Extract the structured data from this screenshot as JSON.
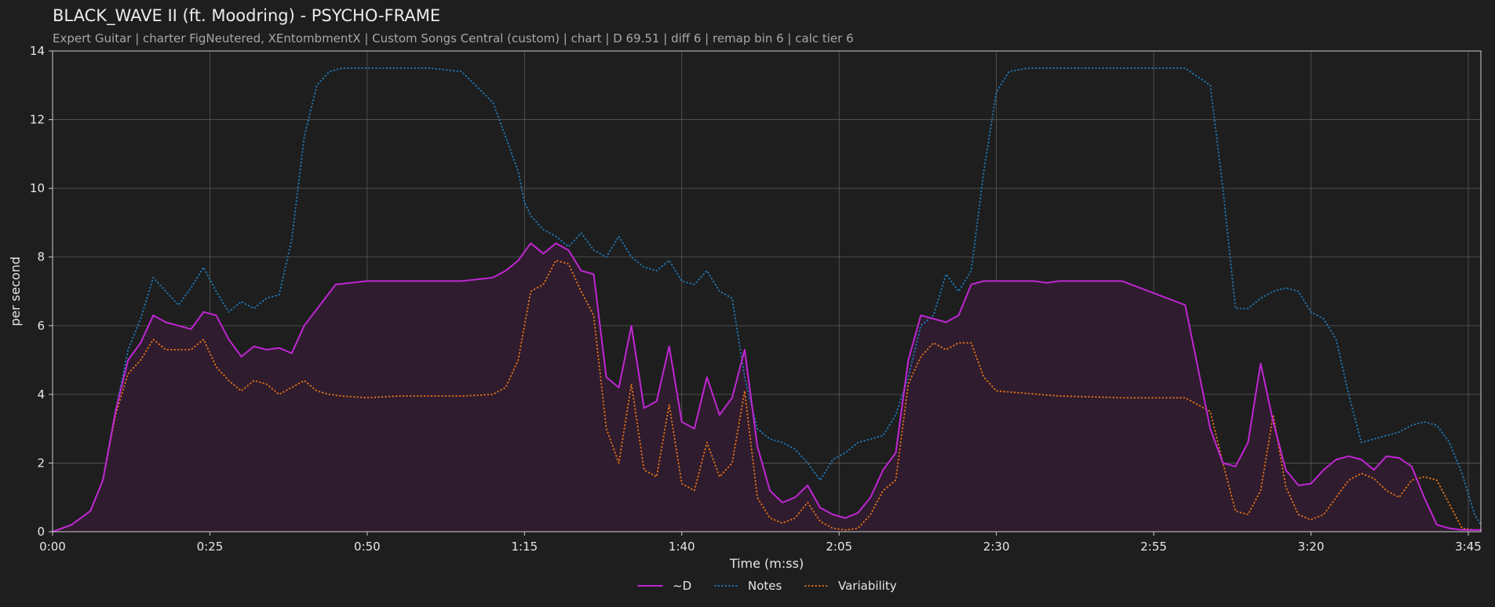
{
  "header": {
    "title": "BLACK_WAVE II (ft. Moodring) - PSYCHO-FRAME",
    "subtitle": "Expert Guitar  |  charter FigNeutered, XEntombmentX  |  Custom Songs Central (custom)  |  chart  |  D 69.51  |  diff 6  |  remap bin 6  |  calc tier 6"
  },
  "colors": {
    "background": "#1e1e1e",
    "d_line": "#c026d3",
    "d_fill": "#2f1c2e",
    "notes": "#1f77b4",
    "variability": "#e0701a",
    "grid": "#5a5a5a",
    "axis": "#cfcfcf"
  },
  "chart_data": {
    "type": "line",
    "title": "BLACK_WAVE II (ft. Moodring) - PSYCHO-FRAME",
    "xlabel": "Time (m:ss)",
    "ylabel": "per second",
    "xlim": [
      0,
      227
    ],
    "ylim": [
      0,
      14
    ],
    "grid": true,
    "legend_position": "bottom-center",
    "x_ticks": [
      0,
      25,
      50,
      75,
      100,
      125,
      150,
      175,
      200,
      225
    ],
    "x_tick_labels": [
      "0:00",
      "0:25",
      "0:50",
      "1:15",
      "1:40",
      "2:05",
      "2:30",
      "2:55",
      "3:20",
      "3:45"
    ],
    "y_ticks": [
      0,
      2,
      4,
      6,
      8,
      10,
      12,
      14
    ],
    "y_tick_labels": [
      "0",
      "2",
      "4",
      "6",
      "8",
      "10",
      "12",
      "14"
    ],
    "series": [
      {
        "name": "~D",
        "style": "solid",
        "filled": true,
        "x": [
          0,
          3,
          6,
          8,
          10,
          12,
          14,
          16,
          18,
          20,
          22,
          24,
          26,
          28,
          30,
          32,
          34,
          36,
          38,
          40,
          45,
          50,
          55,
          60,
          65,
          70,
          72,
          74,
          76,
          78,
          80,
          82,
          84,
          86,
          88,
          90,
          92,
          94,
          96,
          98,
          100,
          102,
          104,
          106,
          108,
          110,
          112,
          114,
          116,
          118,
          120,
          122,
          124,
          126,
          128,
          130,
          132,
          134,
          136,
          138,
          140,
          142,
          144,
          146,
          148,
          150,
          152,
          154,
          156,
          158,
          160,
          170,
          180,
          184,
          186,
          188,
          190,
          192,
          194,
          196,
          198,
          200,
          202,
          204,
          206,
          208,
          210,
          212,
          214,
          216,
          218,
          220,
          222,
          224,
          226,
          227
        ],
        "y": [
          0.0,
          0.2,
          0.6,
          1.5,
          3.5,
          5.0,
          5.5,
          6.3,
          6.1,
          6.0,
          5.9,
          6.4,
          6.3,
          5.6,
          5.1,
          5.4,
          5.3,
          5.35,
          5.2,
          6.0,
          7.2,
          7.3,
          7.3,
          7.3,
          7.3,
          7.4,
          7.6,
          7.9,
          8.4,
          8.1,
          8.4,
          8.2,
          7.6,
          7.5,
          4.5,
          4.2,
          6.0,
          3.6,
          3.8,
          5.4,
          3.2,
          3.0,
          4.5,
          3.4,
          3.9,
          5.3,
          2.5,
          1.2,
          0.85,
          1.0,
          1.35,
          0.7,
          0.5,
          0.4,
          0.55,
          1.0,
          1.8,
          2.3,
          5.0,
          6.3,
          6.2,
          6.1,
          6.3,
          7.2,
          7.3,
          7.3,
          7.3,
          7.3,
          7.3,
          7.25,
          7.3,
          7.3,
          6.6,
          3.0,
          2.0,
          1.9,
          2.6,
          4.9,
          3.2,
          1.8,
          1.35,
          1.4,
          1.8,
          2.1,
          2.2,
          2.1,
          1.8,
          2.2,
          2.15,
          1.9,
          1.0,
          0.2,
          0.1,
          0.05,
          0.05,
          0.05
        ]
      },
      {
        "name": "Notes",
        "style": "dotted",
        "filled": false,
        "x": [
          0,
          3,
          6,
          8,
          10,
          12,
          14,
          16,
          18,
          20,
          22,
          24,
          26,
          28,
          30,
          32,
          34,
          36,
          38,
          40,
          42,
          44,
          46,
          50,
          55,
          60,
          65,
          70,
          72,
          74,
          75,
          76,
          78,
          80,
          82,
          84,
          86,
          88,
          90,
          92,
          94,
          96,
          98,
          100,
          102,
          104,
          106,
          108,
          110,
          112,
          114,
          116,
          118,
          120,
          122,
          124,
          126,
          128,
          130,
          132,
          134,
          136,
          138,
          140,
          142,
          144,
          146,
          148,
          150,
          152,
          155,
          160,
          170,
          180,
          184,
          186,
          188,
          190,
          192,
          194,
          196,
          198,
          200,
          202,
          204,
          206,
          208,
          210,
          212,
          214,
          216,
          218,
          220,
          222,
          224,
          226,
          227
        ],
        "y": [
          0.0,
          0.2,
          0.6,
          1.5,
          3.5,
          5.3,
          6.2,
          7.4,
          7.0,
          6.6,
          7.1,
          7.7,
          7.0,
          6.4,
          6.7,
          6.5,
          6.8,
          6.9,
          8.5,
          11.5,
          13.0,
          13.4,
          13.5,
          13.5,
          13.5,
          13.5,
          13.4,
          12.5,
          11.5,
          10.5,
          9.6,
          9.2,
          8.8,
          8.6,
          8.3,
          8.7,
          8.2,
          8.0,
          8.6,
          8.0,
          7.7,
          7.6,
          7.9,
          7.3,
          7.2,
          7.6,
          7.0,
          6.8,
          4.5,
          3.0,
          2.7,
          2.6,
          2.4,
          2.0,
          1.5,
          2.1,
          2.3,
          2.6,
          2.7,
          2.8,
          3.4,
          4.5,
          6.0,
          6.3,
          7.5,
          7.0,
          7.6,
          10.5,
          12.8,
          13.4,
          13.5,
          13.5,
          13.5,
          13.5,
          13.0,
          10.0,
          6.5,
          6.5,
          6.8,
          7.0,
          7.1,
          7.0,
          6.4,
          6.2,
          5.6,
          4.0,
          2.6,
          2.7,
          2.8,
          2.9,
          3.1,
          3.2,
          3.1,
          2.6,
          1.7,
          0.5,
          0.2
        ]
      },
      {
        "name": "Variability",
        "style": "dotted",
        "filled": false,
        "x": [
          0,
          3,
          6,
          8,
          10,
          12,
          14,
          16,
          18,
          20,
          22,
          24,
          26,
          28,
          30,
          32,
          34,
          36,
          38,
          40,
          42,
          44,
          46,
          50,
          55,
          60,
          65,
          70,
          72,
          74,
          76,
          78,
          80,
          82,
          84,
          86,
          88,
          90,
          92,
          94,
          96,
          98,
          100,
          102,
          104,
          106,
          108,
          110,
          112,
          114,
          116,
          118,
          120,
          122,
          124,
          126,
          128,
          130,
          132,
          134,
          136,
          138,
          140,
          142,
          144,
          146,
          148,
          150,
          160,
          170,
          180,
          184,
          186,
          188,
          190,
          192,
          194,
          196,
          198,
          200,
          202,
          204,
          206,
          208,
          210,
          212,
          214,
          216,
          218,
          220,
          222,
          224,
          226,
          227
        ],
        "y": [
          0.0,
          0.2,
          0.6,
          1.5,
          3.4,
          4.6,
          5.0,
          5.6,
          5.3,
          5.3,
          5.3,
          5.6,
          4.8,
          4.4,
          4.1,
          4.4,
          4.3,
          4.0,
          4.2,
          4.4,
          4.1,
          4.0,
          3.95,
          3.9,
          3.95,
          3.95,
          3.95,
          4.0,
          4.2,
          5.0,
          7.0,
          7.2,
          7.9,
          7.8,
          7.0,
          6.3,
          3.0,
          2.0,
          4.3,
          1.8,
          1.6,
          3.7,
          1.4,
          1.2,
          2.6,
          1.6,
          2.0,
          4.1,
          1.0,
          0.4,
          0.25,
          0.4,
          0.85,
          0.3,
          0.1,
          0.05,
          0.1,
          0.5,
          1.2,
          1.5,
          4.3,
          5.1,
          5.5,
          5.3,
          5.5,
          5.5,
          4.5,
          4.1,
          3.95,
          3.9,
          3.9,
          3.5,
          2.0,
          0.6,
          0.5,
          1.2,
          3.4,
          1.3,
          0.5,
          0.35,
          0.5,
          1.0,
          1.5,
          1.7,
          1.55,
          1.2,
          1.0,
          1.5,
          1.6,
          1.5,
          0.8,
          0.1,
          0.05,
          0.05
        ]
      }
    ]
  }
}
